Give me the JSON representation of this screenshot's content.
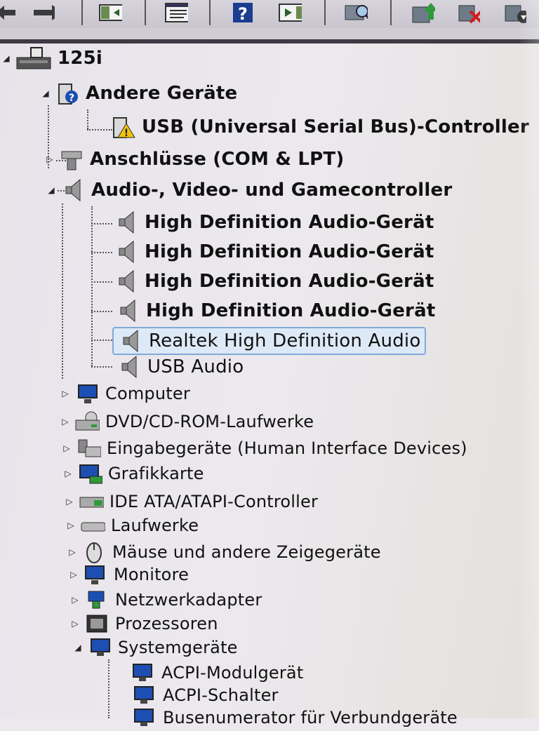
{
  "tree": {
    "root": {
      "label": "125i"
    },
    "other_devices": {
      "label": "Andere Geräte",
      "children": [
        "USB (Universal Serial Bus)-Controller"
      ]
    },
    "ports": {
      "label": "Anschlüsse (COM & LPT)"
    },
    "audio": {
      "label": "Audio-, Video- und Gamecontroller",
      "children": [
        "High Definition Audio-Gerät",
        "High Definition Audio-Gerät",
        "High Definition Audio-Gerät",
        "High Definition Audio-Gerät",
        "Realtek High Definition Audio",
        "USB Audio"
      ]
    },
    "categories": [
      "Computer",
      "DVD/CD-ROM-Laufwerke",
      "Eingabegeräte (Human Interface Devices)",
      "Grafikkarte",
      "IDE ATA/ATAPI-Controller",
      "Laufwerke",
      "Mäuse und andere Zeigegeräte",
      "Monitore",
      "Netzwerkadapter",
      "Prozessoren"
    ],
    "system": {
      "label": "Systemgeräte",
      "children": [
        "ACPI-Modulgerät",
        "ACPI-Schalter",
        "Busenumerator für Verbundgeräte"
      ]
    }
  },
  "icons": {
    "toolbar": [
      "back-arrow-icon",
      "forward-arrow-icon",
      "show-hide-console-tree-icon",
      "properties-icon",
      "help-icon",
      "action-pane-icon",
      "scan-hardware-icon",
      "update-driver-icon",
      "disable-device-icon",
      "uninstall-device-icon"
    ]
  },
  "colors": {
    "selection_border": "#7fa9d8",
    "selection_fill": "#dde9f6",
    "help_blue": "#1b3c8f"
  }
}
